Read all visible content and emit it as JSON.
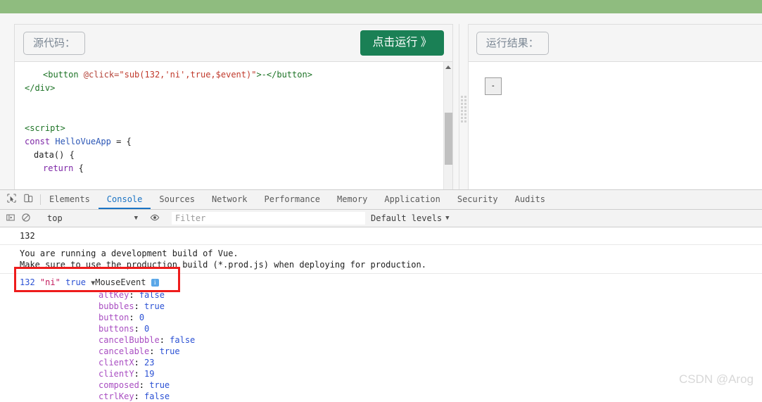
{
  "top_bar": {
    "color": "#8fbc7f"
  },
  "editor_panel": {
    "header_label": "源代码：",
    "run_button": "点击运行 》",
    "code_lines": [
      {
        "indent": 1,
        "tokens": [
          {
            "t": "tag",
            "v": "<button "
          },
          {
            "t": "attr",
            "v": "@click="
          },
          {
            "t": "str",
            "v": "\"sub(132,'ni',true,$event)\""
          },
          {
            "t": "tag",
            "v": ">-</button>"
          }
        ]
      },
      {
        "indent": 0,
        "tokens": [
          {
            "t": "tag",
            "v": "</div>"
          }
        ]
      },
      {
        "indent": 0,
        "tokens": [
          {
            "t": "pl",
            "v": ""
          }
        ]
      },
      {
        "indent": 0,
        "tokens": [
          {
            "t": "pl",
            "v": ""
          }
        ]
      },
      {
        "indent": 0,
        "tokens": [
          {
            "t": "tag",
            "v": "<script>"
          }
        ]
      },
      {
        "indent": 0,
        "tokens": [
          {
            "t": "kw",
            "v": "const "
          },
          {
            "t": "var",
            "v": "HelloVueApp"
          },
          {
            "t": "pl",
            "v": " = {"
          }
        ]
      },
      {
        "indent": 2,
        "tokens": [
          {
            "t": "pl",
            "v": "data() {"
          }
        ]
      },
      {
        "indent": 3,
        "tokens": [
          {
            "t": "kw",
            "v": "return"
          },
          {
            "t": "pl",
            "v": " {"
          }
        ]
      }
    ]
  },
  "result_panel": {
    "header_label": "运行结果：",
    "output_button": "-"
  },
  "devtools": {
    "tabs": [
      {
        "label": "Elements",
        "active": false
      },
      {
        "label": "Console",
        "active": true
      },
      {
        "label": "Sources",
        "active": false
      },
      {
        "label": "Network",
        "active": false
      },
      {
        "label": "Performance",
        "active": false
      },
      {
        "label": "Memory",
        "active": false
      },
      {
        "label": "Application",
        "active": false
      },
      {
        "label": "Security",
        "active": false
      },
      {
        "label": "Audits",
        "active": false
      }
    ],
    "filter_bar": {
      "context": "top",
      "filter_placeholder": "Filter",
      "filter_value": "",
      "levels": "Default levels"
    },
    "console_entries": [
      {
        "type": "plain",
        "text": "132"
      },
      {
        "type": "warn_block",
        "lines": [
          "You are running a development build of Vue.",
          "Make sure to use the production build (*.prod.js) when deploying for production."
        ]
      }
    ],
    "logged_values": {
      "number": "132",
      "string": "\"ni\"",
      "boolean": "true",
      "object": "MouseEvent"
    },
    "mouse_event_props": [
      {
        "key": "altKey",
        "value": "false",
        "kind": "bool"
      },
      {
        "key": "bubbles",
        "value": "true",
        "kind": "bool"
      },
      {
        "key": "button",
        "value": "0",
        "kind": "num"
      },
      {
        "key": "buttons",
        "value": "0",
        "kind": "num"
      },
      {
        "key": "cancelBubble",
        "value": "false",
        "kind": "bool"
      },
      {
        "key": "cancelable",
        "value": "true",
        "kind": "bool"
      },
      {
        "key": "clientX",
        "value": "23",
        "kind": "num"
      },
      {
        "key": "clientY",
        "value": "19",
        "kind": "num"
      },
      {
        "key": "composed",
        "value": "true",
        "kind": "bool"
      },
      {
        "key": "ctrlKey",
        "value": "false",
        "kind": "bool"
      }
    ],
    "highlight_color": "#ee1c1c"
  },
  "watermark": "CSDN @Arog"
}
